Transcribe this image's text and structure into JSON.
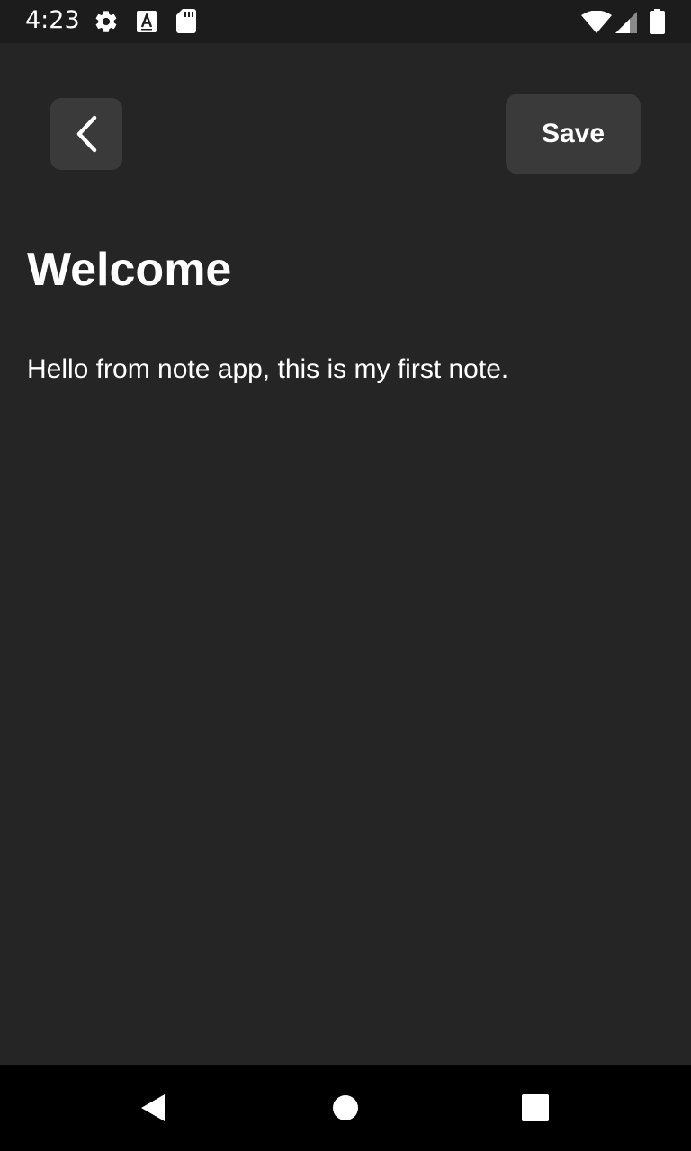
{
  "status_bar": {
    "time": "4:23",
    "left_icons": [
      "gear-icon",
      "font-a-icon",
      "sd-card-icon"
    ],
    "right_icons": [
      "wifi-icon",
      "cell-signal-icon",
      "battery-icon"
    ]
  },
  "toolbar": {
    "back_icon": "chevron-left-icon",
    "save_label": "Save"
  },
  "note": {
    "title": "Welcome",
    "body": "Hello from note app, this is my first note."
  },
  "nav_bar": {
    "buttons": [
      "back-triangle-icon",
      "home-circle-icon",
      "recents-square-icon"
    ]
  },
  "colors": {
    "background": "#252525",
    "status_bar": "#1c1c1c",
    "button_bg": "#3a3a3a",
    "nav_bar": "#000000",
    "text": "#ffffff"
  }
}
